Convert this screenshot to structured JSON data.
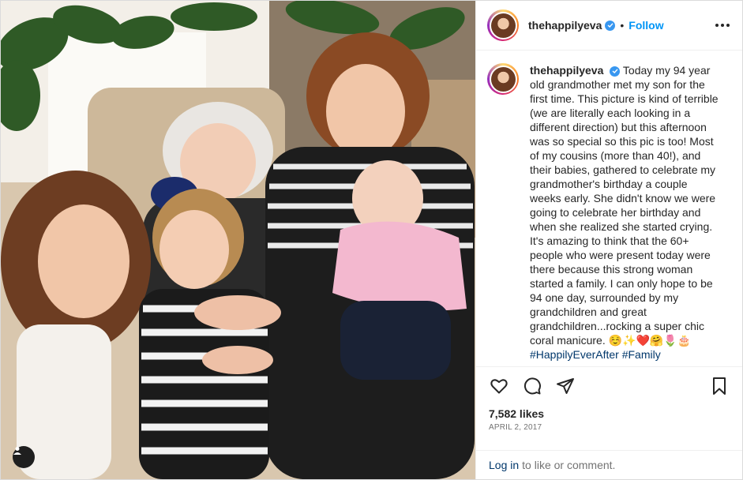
{
  "post": {
    "username": "thehappilyeva",
    "verified": true,
    "follow_label": "Follow",
    "separator": "•",
    "caption": "Today my 94 year old grandmother met my son for the first time. This picture is kind of terrible (we are literally each looking in a different direction) but this afternoon was so special so this pic is too! Most of my cousins (more than 40!), and their babies, gathered to celebrate my grandmother's birthday a couple weeks early. She didn't know we were going to celebrate her birthday and when she realized she started crying. It's amazing to think that the 60+ people who were present today were there because this strong woman started a family. I can only hope to be 94 one day, surrounded by my grandchildren and great grandchildren...rocking a super chic coral manicure. ☺️✨❤️🤗🌷🎂",
    "hashtags": "#HappilyEverAfter #Family",
    "likes": "7,582 likes",
    "date": "APRIL 2, 2017"
  },
  "footer": {
    "login_link": "Log in",
    "login_text": "to like or comment."
  },
  "icons": {
    "like": "heart-icon",
    "comment": "comment-icon",
    "share": "paper-plane-icon",
    "save": "bookmark-icon",
    "more": "more-options-icon",
    "tag": "user-tag-icon"
  },
  "colors": {
    "accent": "#0095f6",
    "verified": "#3897f0",
    "hashtag": "#00376b",
    "muted": "#737373"
  }
}
